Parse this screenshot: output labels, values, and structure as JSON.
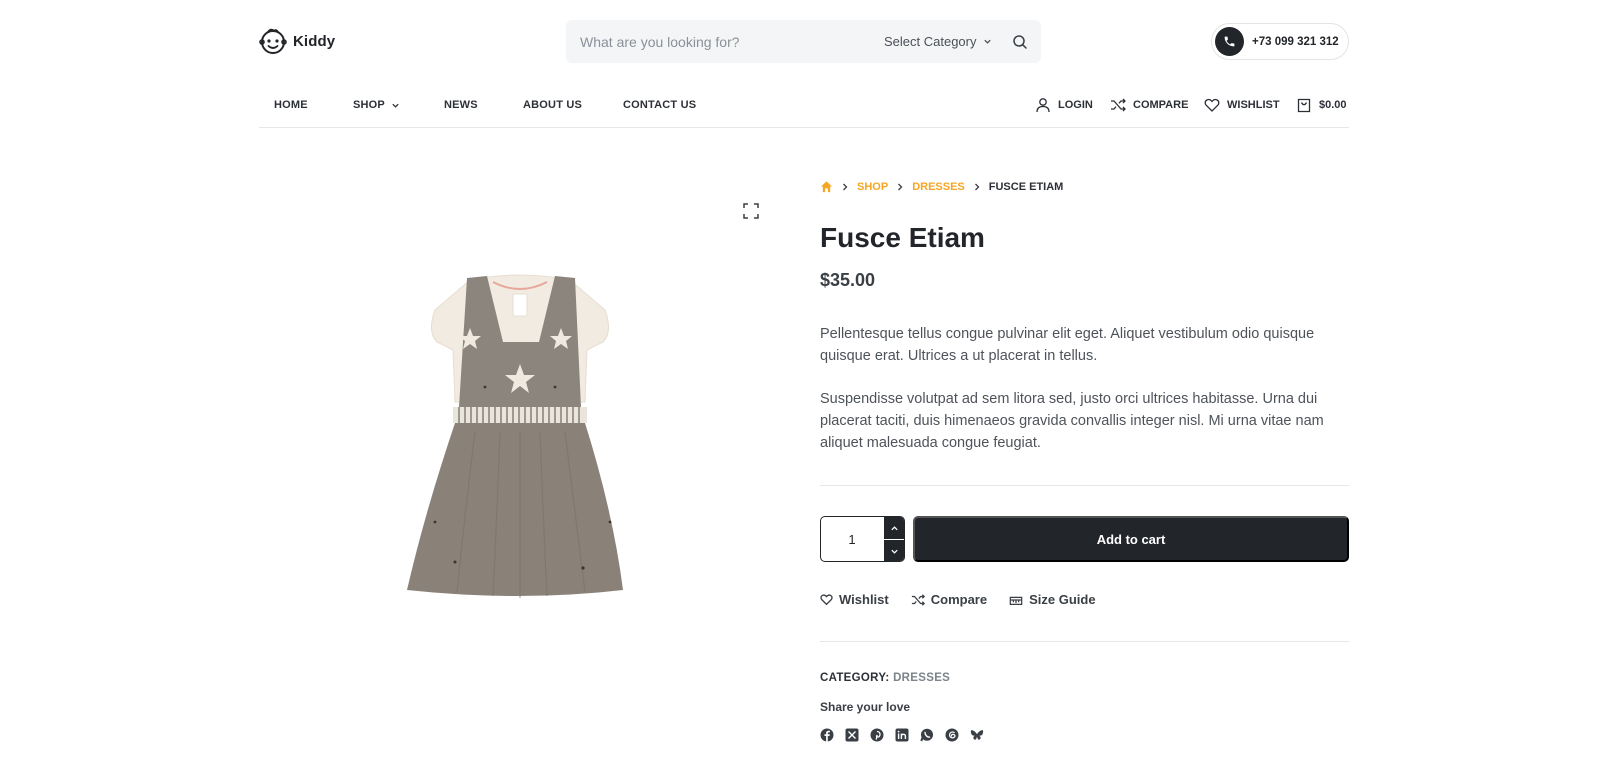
{
  "brand": {
    "name": "Kiddy"
  },
  "search": {
    "placeholder": "What are you looking for?",
    "category_label": "Select Category"
  },
  "phone": "+73 099 321 312",
  "nav": {
    "home": "HOME",
    "shop": "SHOP",
    "news": "NEWS",
    "about": "ABOUT US",
    "contact": "CONTACT US",
    "login": "LOGIN",
    "compare": "COMPARE",
    "wishlist": "WISHLIST",
    "cart_total": "$0.00"
  },
  "breadcrumb": {
    "shop": "SHOP",
    "dresses": "DRESSES",
    "current": "FUSCE ETIAM"
  },
  "product": {
    "title": "Fusce Etiam",
    "price": "$35.00",
    "desc1": "Pellentesque tellus congue pulvinar elit eget. Aliquet vestibulum odio quisque quisque erat. Ultrices a ut placerat in tellus.",
    "desc2": "Suspendisse volutpat ad sem litora sed, justo orci ultrices habitasse. Urna dui placerat taciti, duis himenaeos gravida convallis integer nisl. Mi urna vitae nam aliquet malesuada congue feugiat.",
    "quantity": "1",
    "add_to_cart": "Add to cart",
    "wishlist": "Wishlist",
    "compare": "Compare",
    "size_guide": "Size Guide",
    "category_key": "CATEGORY:",
    "category_value": "DRESSES",
    "share": "Share your love"
  },
  "socials": [
    "facebook-icon",
    "x-icon",
    "pinterest-icon",
    "linkedin-icon",
    "whatsapp-icon",
    "threads-icon",
    "bluesky-icon"
  ],
  "colors": {
    "accent": "#f5a623",
    "dark": "#222529",
    "text": "#4e535a"
  }
}
